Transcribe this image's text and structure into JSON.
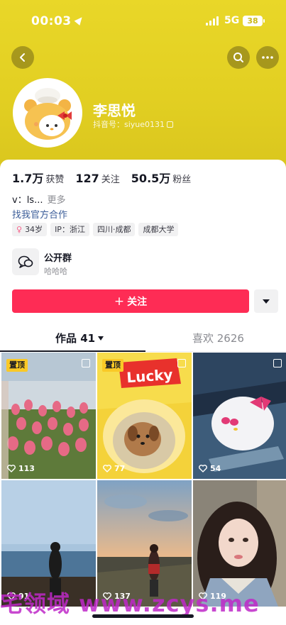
{
  "status_bar": {
    "time": "00:03",
    "network": "5G",
    "battery": "38"
  },
  "profile": {
    "name": "李思悦",
    "douyin_id": "抖音号：siyue0131",
    "stats": [
      {
        "value": "1.7万",
        "label": "获赞"
      },
      {
        "value": "127",
        "label": "关注"
      },
      {
        "value": "50.5万",
        "label": "粉丝"
      }
    ],
    "bio": "v：ls...",
    "bio_more": "更多",
    "business_link": "找我官方合作",
    "tags": [
      "34岁",
      "IP：浙江",
      "四川·成都",
      "成都大学"
    ]
  },
  "group": {
    "title": "公开群",
    "subtitle": "哈哈哈"
  },
  "actions": {
    "follow_label": "关注"
  },
  "tabs": {
    "works": "作品 41",
    "likes": "喜欢 2626"
  },
  "grid": [
    {
      "pinned": true,
      "pin_label": "置顶",
      "likes": "113",
      "scene": "tulips"
    },
    {
      "pinned": true,
      "pin_label": "置顶",
      "likes": "77",
      "scene": "dog"
    },
    {
      "pinned": false,
      "likes": "54",
      "scene": "kitty"
    },
    {
      "pinned": false,
      "likes": "91",
      "scene": "sea"
    },
    {
      "pinned": false,
      "likes": "137",
      "scene": "sunset"
    },
    {
      "pinned": false,
      "likes": "119",
      "scene": "portrait"
    }
  ],
  "watermark": "宅领域 www.zcys.me",
  "colors": {
    "accent": "#fe2c55",
    "header": "#e2cf22",
    "link": "#3b5d99",
    "pin": "#fac926"
  }
}
